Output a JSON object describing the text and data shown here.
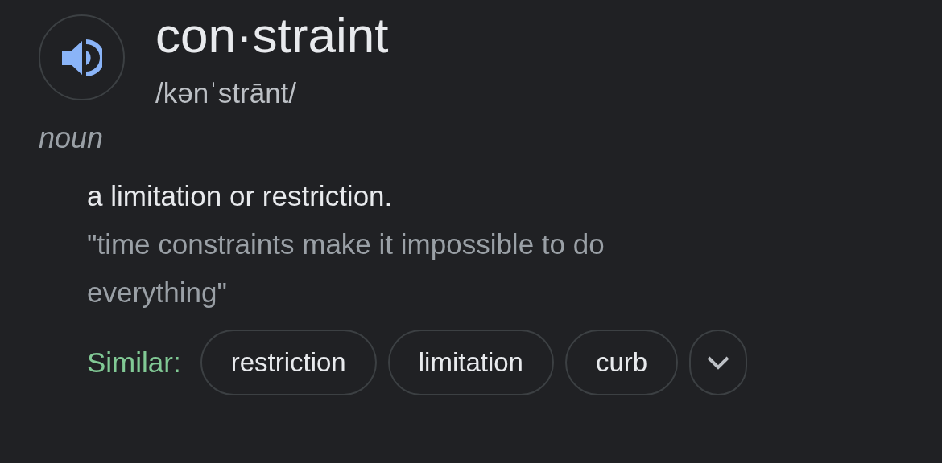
{
  "word": "con·straint",
  "pronunciation": "/kənˈstrānt/",
  "part_of_speech": "noun",
  "definition": "a limitation or restriction.",
  "example": "\"time constraints make it impossible to do everything\"",
  "similar_label": "Similar:",
  "similar": [
    "restriction",
    "limitation",
    "curb"
  ]
}
